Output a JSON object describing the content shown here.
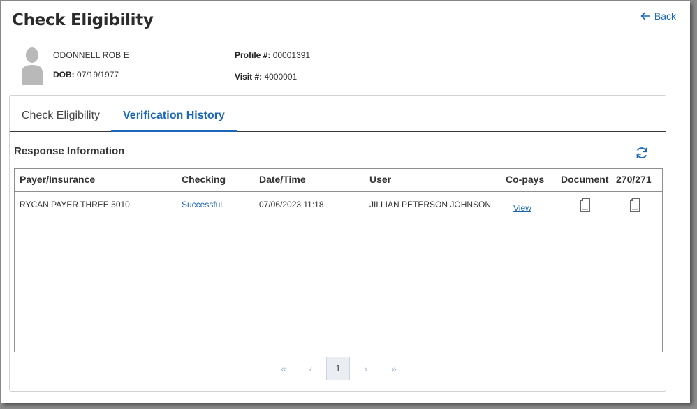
{
  "page": {
    "title": "Check Eligibility",
    "back_label": "Back"
  },
  "patient": {
    "name": "ODONNELL  ROB E",
    "dob_label": "DOB:",
    "dob": "07/19/1977",
    "profile_label": "Profile #:",
    "profile": "00001391",
    "visit_label": "Visit #:",
    "visit": "4000001"
  },
  "tabs": [
    {
      "label": "Check Eligibility",
      "active": false
    },
    {
      "label": "Verification History",
      "active": true
    }
  ],
  "section": {
    "title": "Response Information"
  },
  "table": {
    "columns": [
      "Payer/Insurance",
      "Checking",
      "Date/Time",
      "User",
      "Co-pays",
      "Document",
      "270/271"
    ],
    "rows": [
      {
        "payer": "RYCAN PAYER THREE 5010",
        "checking": "Successful",
        "datetime": "07/06/2023 11:18",
        "user": "JILLIAN PETERSON JOHNSON",
        "copays": "View",
        "document_icon": "document-icon",
        "edi_icon": "document-icon"
      }
    ]
  },
  "pagination": {
    "first": "«",
    "prev": "‹",
    "current": "1",
    "next": "›",
    "last": "»"
  },
  "colors": {
    "accent": "#1a66b8",
    "text": "#333333",
    "border": "#8f8f8f"
  }
}
